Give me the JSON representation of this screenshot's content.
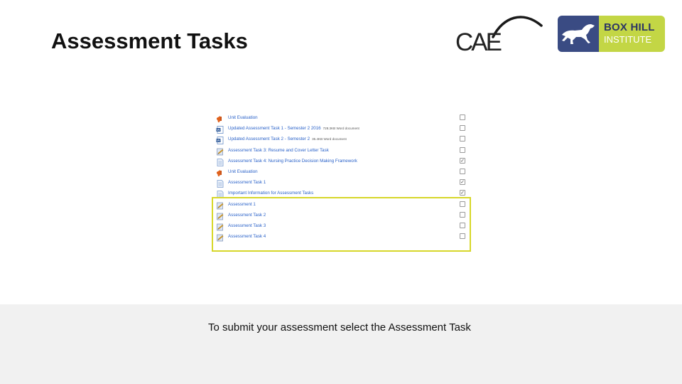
{
  "slide": {
    "title": "Assessment Tasks"
  },
  "logos": {
    "cae": "CAE",
    "boxhill": {
      "line1": "BOX HILL",
      "line2": "INSTITUTE"
    }
  },
  "course_items": [
    {
      "label": "Unit Evaluation",
      "meta": "",
      "icon": "feedback-icon",
      "checked": false
    },
    {
      "label": "Updated Assessment Task 1 - Semester 2 2016",
      "meta": "728.3KB Word document",
      "icon": "word-document-icon",
      "checked": false
    },
    {
      "label": "Updated Assessment Task 2 - Semester 2",
      "meta": "35.4KB Word document",
      "icon": "word-document-icon",
      "checked": false
    },
    {
      "label": "Assessment Task 3: Resume and Cover Letter Task",
      "meta": "",
      "icon": "assignment-icon",
      "checked": false
    },
    {
      "label": "Assessment Task 4: Nursing Practice Decision Making Framework",
      "meta": "",
      "icon": "page-icon",
      "checked": true
    },
    {
      "label": "Unit Evaluation",
      "meta": "",
      "icon": "feedback-icon",
      "checked": false
    },
    {
      "label": "Assessment Task 1",
      "meta": "",
      "icon": "page-icon",
      "checked": true
    },
    {
      "label": "Important Information for Assessment Tasks",
      "meta": "",
      "icon": "page-icon",
      "checked": true
    },
    {
      "label": "Assessment 1",
      "meta": "",
      "icon": "assignment-icon",
      "checked": false
    },
    {
      "label": "Assessment Task 2",
      "meta": "",
      "icon": "assignment-icon",
      "checked": false
    },
    {
      "label": "Assessment Task 3",
      "meta": "",
      "icon": "assignment-icon",
      "checked": false
    },
    {
      "label": "Assessment Task 4",
      "meta": "",
      "icon": "assignment-icon",
      "checked": false
    }
  ],
  "footer": {
    "instruction": "To submit your assessment select the Assessment Task"
  },
  "colors": {
    "link": "#2a62c9",
    "highlight": "#d7d72a",
    "boxhill_blue": "#3a4b83",
    "boxhill_green": "#c3d645"
  }
}
